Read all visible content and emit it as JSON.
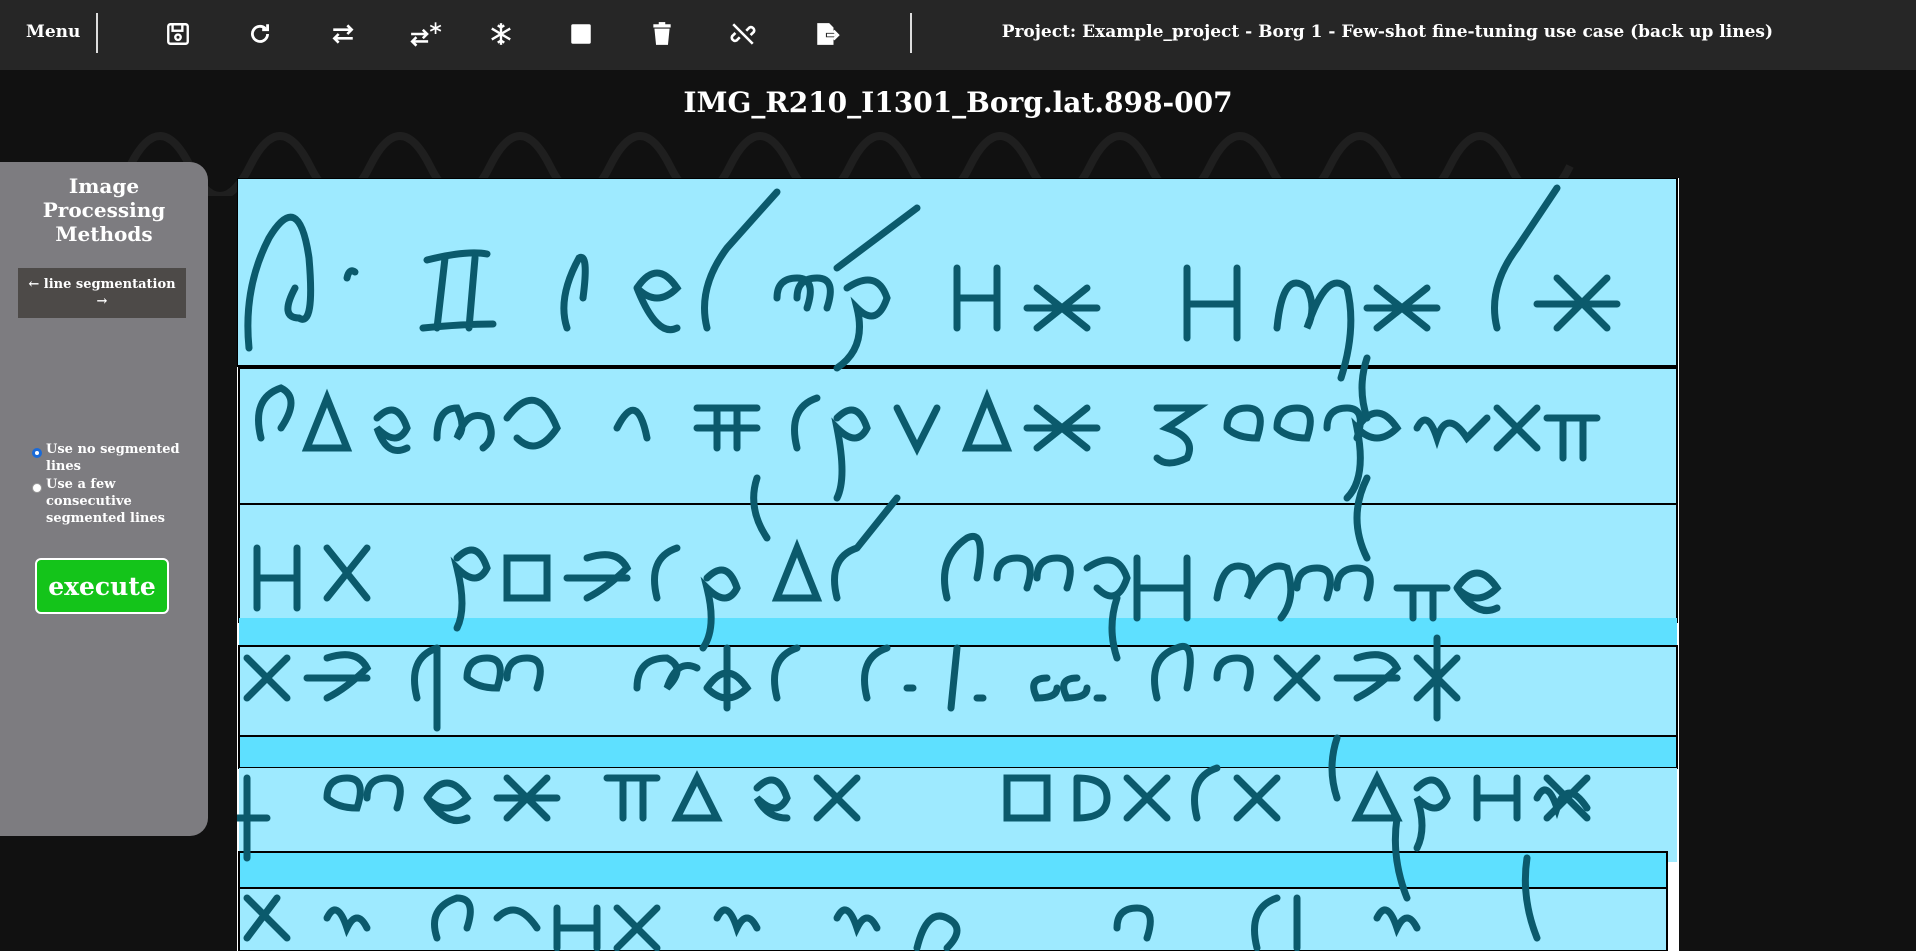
{
  "toolbar": {
    "menu_label": "Menu",
    "tools": [
      {
        "name": "save-icon"
      },
      {
        "name": "reload-icon"
      },
      {
        "name": "swap-arrows-icon"
      },
      {
        "name": "swap-arrows-freeze-icon"
      },
      {
        "name": "snowflake-icon"
      },
      {
        "name": "stop-square-icon"
      },
      {
        "name": "trash-icon"
      },
      {
        "name": "unlink-icon"
      },
      {
        "name": "export-file-icon"
      }
    ],
    "project_title": "Project: Example_project - Borg 1 - Few-shot fine-tuning use case (back up lines)"
  },
  "image_title": "IMG_R210_I1301_Borg.lat.898-007",
  "sidebar": {
    "title_line1": "Image",
    "title_line2": "Processing",
    "title_line3": "Methods",
    "method_button": "← line segmentation →",
    "options": [
      {
        "label": "Use no segmented lines",
        "selected": true
      },
      {
        "label": "Use a few consecutive segmented lines",
        "selected": false
      }
    ],
    "execute_label": "execute"
  },
  "colors": {
    "topbar": "#262626",
    "sidebar": "#7d7c80",
    "execute": "#14c41a",
    "line_fill": "#9eeaff",
    "ink": "#0b5a6c"
  },
  "document": {
    "line_count": 7
  }
}
